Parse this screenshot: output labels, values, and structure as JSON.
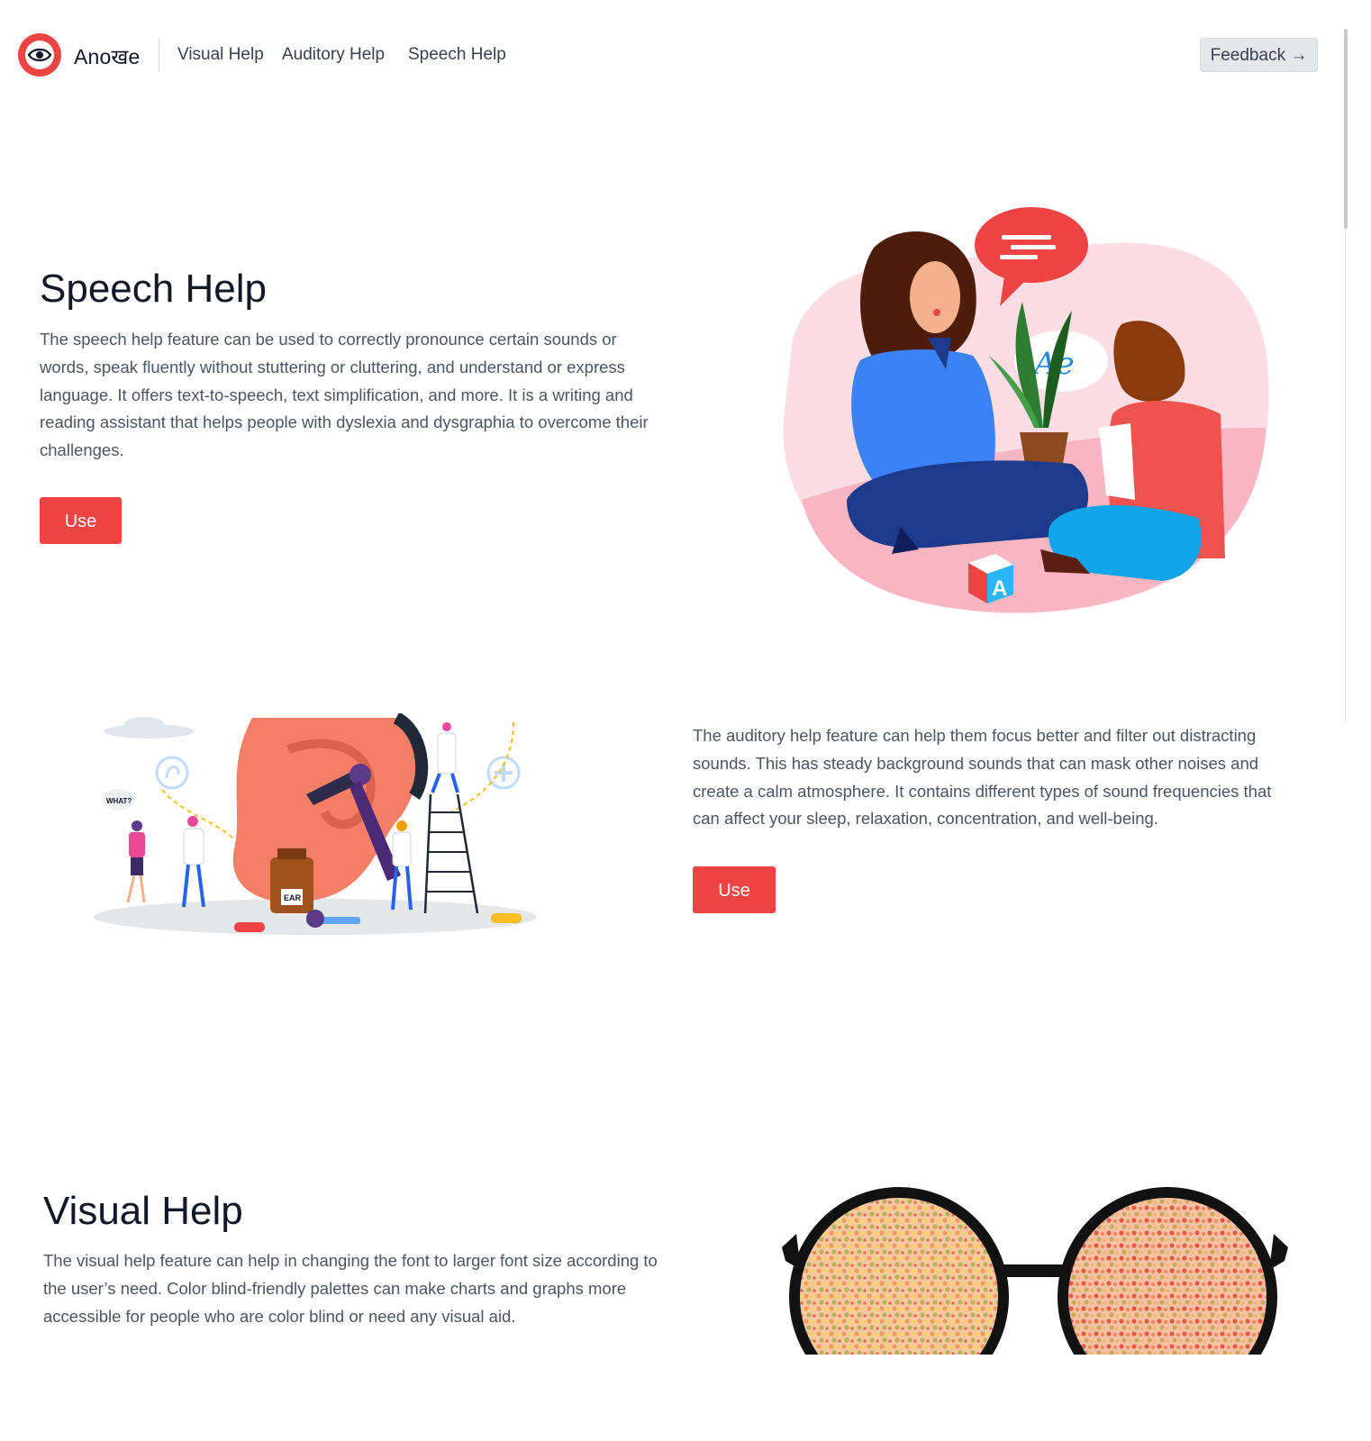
{
  "nav": {
    "brand": "Anoखe",
    "links": [
      "Visual Help",
      "Auditory Help",
      "Speech Help"
    ],
    "feedback_label": "Feedback",
    "feedback_arrow": "→"
  },
  "speech": {
    "title": "Speech Help",
    "text": "The speech help feature can be used to correctly pronounce certain sounds or words, speak fluently without stuttering or cluttering, and understand or express language. It offers text-to-speech, text simplification, and more. It is a writing and reading assistant that helps people with dyslexia and dysgraphia to overcome their challenges.",
    "button": "Use",
    "bubble_text": "Ae",
    "block_letter": "A"
  },
  "auditory": {
    "text": "The auditory help feature can help them focus better and filter out distracting sounds. This has steady background sounds that can mask other noises and create a calm atmosphere. It contains different types of sound frequencies that can affect your sleep, relaxation, concentration, and well-being.",
    "button": "Use",
    "bubble_text": "WHAT?",
    "bottle_label": "EAR"
  },
  "visual": {
    "title": "Visual Help",
    "text": "The visual help feature can help in changing the font to larger font size according to the user’s need. Color blind-friendly palettes can make charts and graphs more accessible for people who are color blind or need any visual aid."
  },
  "colors": {
    "accent": "#ef4444",
    "text_dark": "#111827",
    "text_body": "#4b5563",
    "feedback_bg": "#e5e7eb"
  },
  "icons": [
    "eye-icon",
    "arrow-right-icon",
    "speech-bubble-icon",
    "plus-icon",
    "ear-icon",
    "cloud-icon"
  ]
}
